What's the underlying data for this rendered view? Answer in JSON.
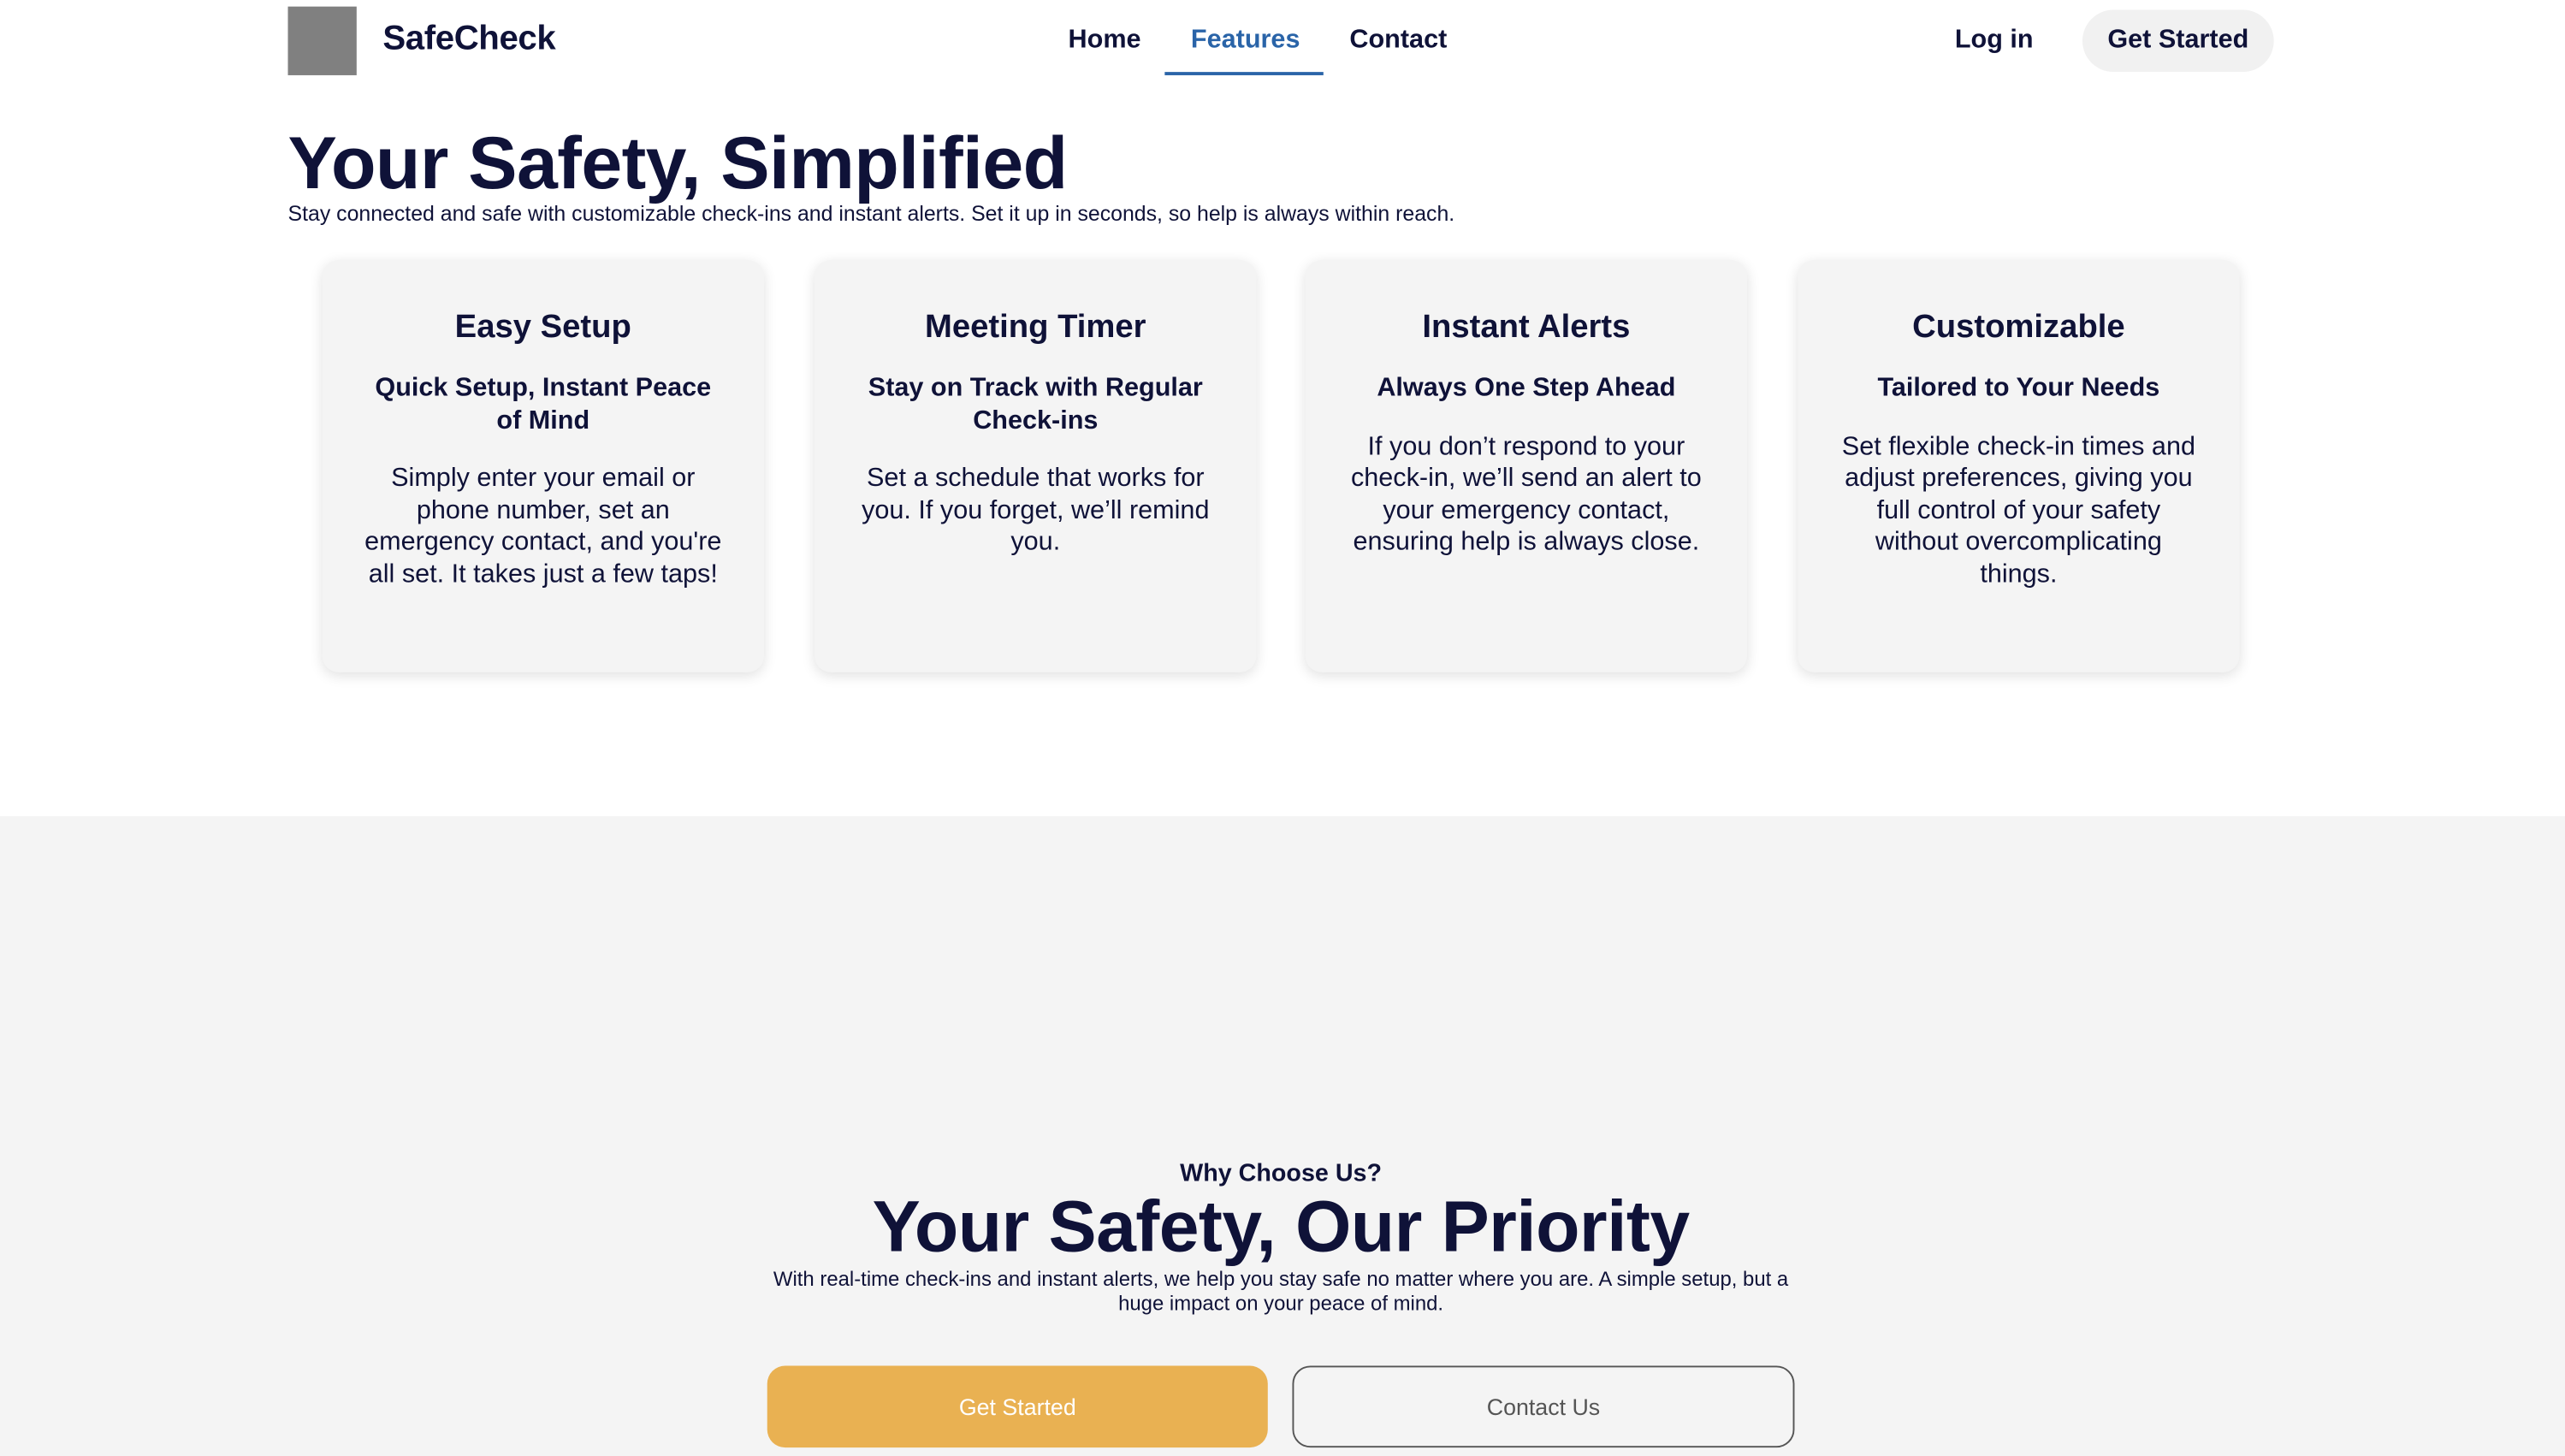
{
  "header": {
    "brand": "SafeCheck",
    "logo_icon": "logo-placeholder",
    "nav": [
      {
        "label": "Home",
        "active": false
      },
      {
        "label": "Features",
        "active": true
      },
      {
        "label": "Contact",
        "active": false
      }
    ],
    "login_label": "Log in",
    "cta_label": "Get Started"
  },
  "hero": {
    "title": "Your Safety, Simplified",
    "subtitle": "Stay connected and safe with customizable check-ins and instant alerts. Set it up in seconds, so help is always within reach."
  },
  "features": [
    {
      "title": "Easy Setup",
      "subtitle": "Quick Setup, Instant Peace of Mind",
      "body": "Simply enter your email or phone number, set an emergency contact, and you're all set. It takes just a few taps!"
    },
    {
      "title": "Meeting Timer",
      "subtitle": "Stay on Track with Regular Check-ins",
      "body": "Set a schedule that works for you. If you forget, we’ll remind you."
    },
    {
      "title": "Instant Alerts",
      "subtitle": "Always One Step Ahead",
      "body": "If you don’t respond to your check-in, we’ll send an alert to your emergency contact, ensuring help is always close."
    },
    {
      "title": "Customizable",
      "subtitle": "Tailored to Your Needs",
      "body": "Set flexible check-in times and adjust preferences, giving you full control of your safety without overcomplicating things."
    }
  ],
  "why": {
    "eyebrow": "Why Choose Us?",
    "title": "Your Safety, Our Priority",
    "body": "With real-time check-ins and instant alerts, we help you stay safe no matter where you are. A simple setup, but a huge impact on your peace of mind.",
    "primary_label": "Get Started",
    "secondary_label": "Contact Us"
  },
  "colors": {
    "text": "#0f1238",
    "active_nav": "#2a64a8",
    "primary_button": "#e9b152",
    "card_bg": "#f4f4f4",
    "section_bg": "#f4f4f4"
  }
}
